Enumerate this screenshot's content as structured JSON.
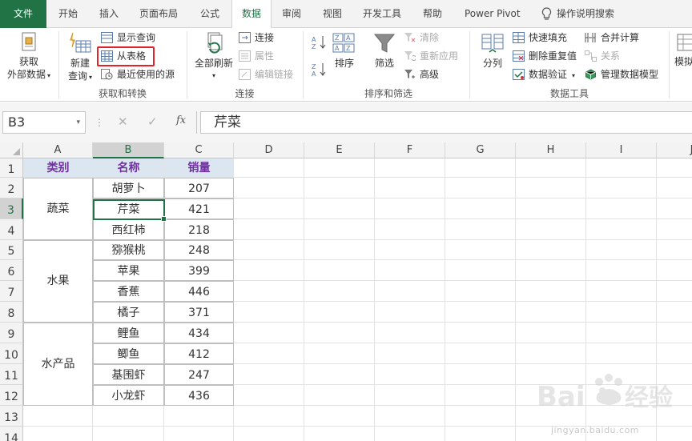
{
  "tabs": {
    "file": "文件",
    "home": "开始",
    "insert": "插入",
    "layout": "页面布局",
    "formulas": "公式",
    "data": "数据",
    "review": "审阅",
    "view": "视图",
    "developer": "开发工具",
    "help": "帮助",
    "powerpivot": "Power Pivot",
    "tellme": "操作说明搜索"
  },
  "ribbon": {
    "get_external": {
      "line1": "获取",
      "line2": "外部数据"
    },
    "new_query": {
      "line1": "新建",
      "line2": "查询"
    },
    "show_queries": "显示查询",
    "from_table": "从表格",
    "recent_sources": "最近使用的源",
    "group_get": "获取和转换",
    "refresh_all": "全部刷新",
    "connections": "连接",
    "properties": "属性",
    "edit_links": "编辑链接",
    "group_conn": "连接",
    "sort": "排序",
    "filter": "筛选",
    "clear": "清除",
    "reapply": "重新应用",
    "advanced": "高级",
    "group_sort": "排序和筛选",
    "text_to_col": "分列",
    "flash_fill": "快速填充",
    "remove_dup": "删除重复值",
    "validation": "数据验证",
    "consolidate": "合并计算",
    "relations": "关系",
    "data_model": "管理数据模型",
    "group_tools": "数据工具",
    "model_trunc": "模拟"
  },
  "formula_bar": {
    "name_box": "B3",
    "fx": "fx",
    "content": "芹菜"
  },
  "grid": {
    "columns": [
      "A",
      "B",
      "C",
      "D",
      "E",
      "F",
      "G",
      "H",
      "I",
      "J"
    ],
    "selected_column": "B",
    "rows": [
      "1",
      "2",
      "3",
      "4",
      "5",
      "6",
      "7",
      "8",
      "9",
      "10",
      "11",
      "12",
      "13",
      "14"
    ],
    "selected_row": "3",
    "header": {
      "category": "类别",
      "name": "名称",
      "sales": "销量"
    },
    "groups": [
      {
        "category": "蔬菜",
        "items": [
          {
            "name": "胡萝卜",
            "sales": "207"
          },
          {
            "name": "芹菜",
            "sales": "421"
          },
          {
            "name": "西红柿",
            "sales": "218"
          }
        ]
      },
      {
        "category": "水果",
        "items": [
          {
            "name": "猕猴桃",
            "sales": "248"
          },
          {
            "name": "苹果",
            "sales": "399"
          },
          {
            "name": "香蕉",
            "sales": "446"
          },
          {
            "name": "橘子",
            "sales": "371"
          }
        ]
      },
      {
        "category": "水产品",
        "items": [
          {
            "name": "鲤鱼",
            "sales": "434"
          },
          {
            "name": "鲫鱼",
            "sales": "412"
          },
          {
            "name": "基围虾",
            "sales": "247"
          },
          {
            "name": "小龙虾",
            "sales": "436"
          }
        ]
      }
    ]
  },
  "watermark": {
    "text": "jingyan.baidu.com"
  },
  "colors": {
    "accent": "#217346",
    "header_fill": "#dce6f1",
    "header_text": "#7030a0",
    "highlight": "#e0242a"
  }
}
